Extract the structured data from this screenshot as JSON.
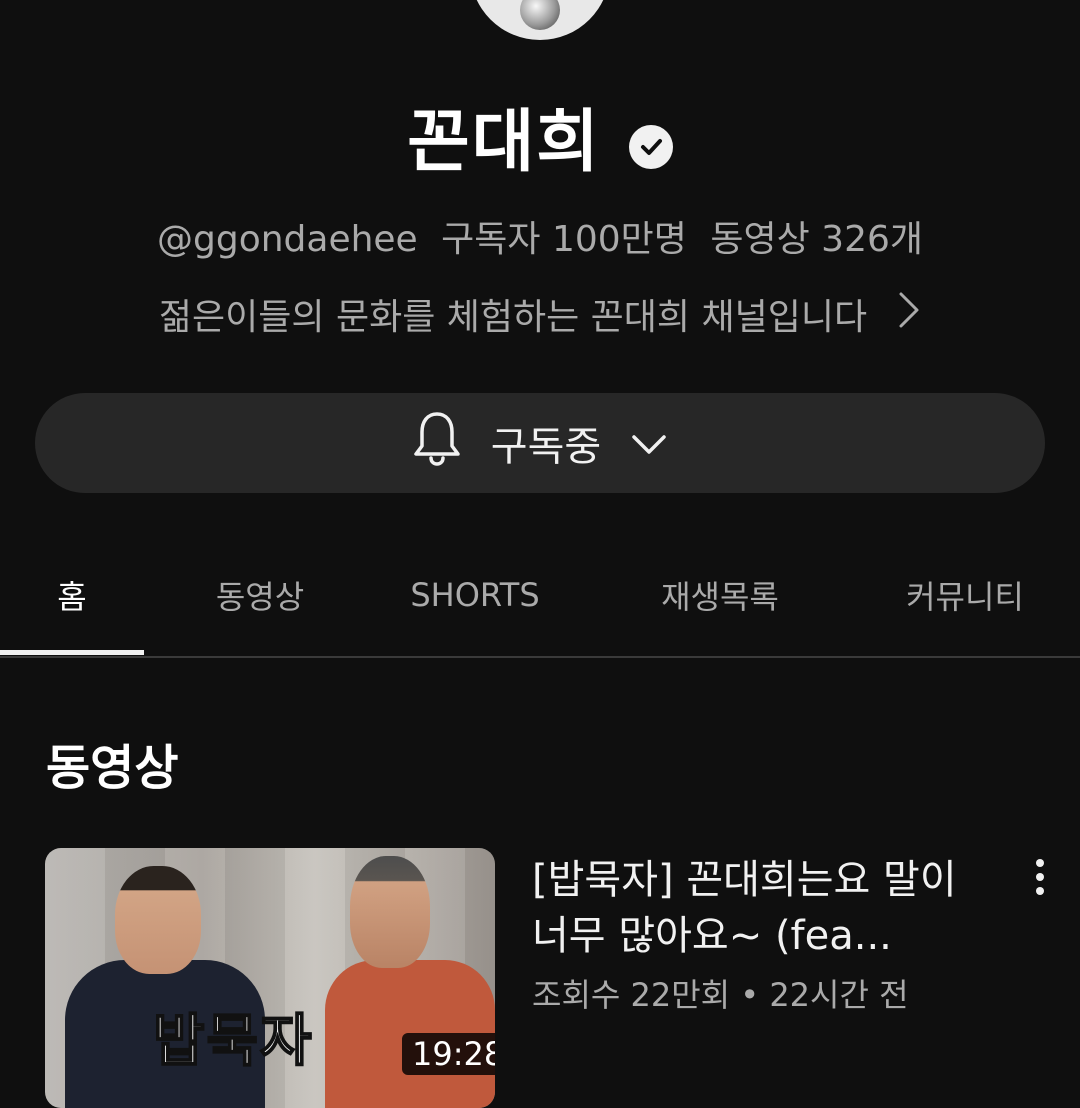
{
  "channel": {
    "name": "꼰대희",
    "handle": "@ggondaehee",
    "subscribers": "구독자 100만명",
    "video_count": "동영상 326개",
    "description": "젊은이들의 문화를 체험하는 꼰대희 채널입니다",
    "verified_icon": "check-circle-icon",
    "avatar_icon": "avatar"
  },
  "subscribe_button": {
    "label": "구독중",
    "bell_icon": "bell-icon",
    "chevron_icon": "chevron-down-icon"
  },
  "tabs": [
    {
      "label": "홈",
      "active": true
    },
    {
      "label": "동영상",
      "active": false
    },
    {
      "label": "SHORTS",
      "active": false
    },
    {
      "label": "재생목록",
      "active": false
    },
    {
      "label": "커뮤니티",
      "active": false
    }
  ],
  "section": {
    "title": "동영상"
  },
  "videos": [
    {
      "title": "[밥묵자] 꼰대희는요 말이 너무 많아요~ (fea...",
      "views": "조회수 22만회",
      "separator": "•",
      "age": "22시간 전",
      "duration": "19:28",
      "thumbnail_caption": "밥묵자"
    }
  ],
  "colors": {
    "background": "#0f0f0f",
    "button_bg": "#272727",
    "primary_text": "#f1f1f1",
    "secondary_text": "#aaaaaa"
  }
}
